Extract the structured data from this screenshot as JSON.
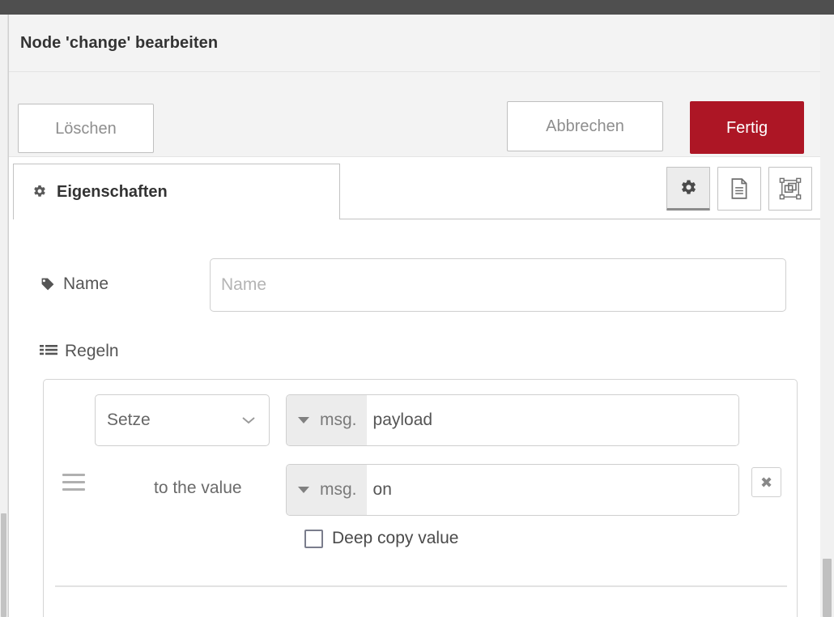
{
  "window": {
    "title": "Node 'change' bearbeiten"
  },
  "toolbar": {
    "delete_label": "Löschen",
    "cancel_label": "Abbrechen",
    "done_label": "Fertig",
    "done_color": "#ad1625"
  },
  "tabs": [
    {
      "label": "Eigenschaften",
      "icon": "gear-icon",
      "active": true
    }
  ],
  "tab_icon_buttons": [
    {
      "name": "properties-icon",
      "active": true
    },
    {
      "name": "description-icon",
      "active": false
    },
    {
      "name": "appearance-icon",
      "active": false
    }
  ],
  "form": {
    "name": {
      "label": "Name",
      "icon": "tag-icon",
      "value": "",
      "placeholder": "Name"
    },
    "rules": {
      "label": "Regeln",
      "icon": "list-icon",
      "rows": [
        {
          "action": "Setze",
          "target_prefix": "msg.",
          "target_value": "payload"
        },
        {
          "to_label": "to the value",
          "value_prefix": "msg.",
          "value_value": "on",
          "remove_label": "✖"
        }
      ],
      "deep_copy": {
        "label": "Deep copy value",
        "checked": false
      }
    }
  }
}
